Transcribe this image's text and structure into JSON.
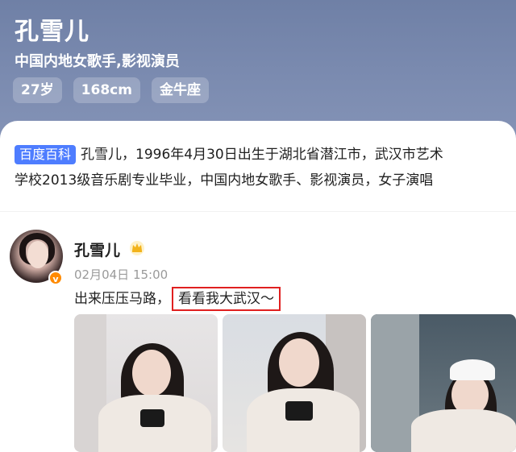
{
  "profile": {
    "name": "孔雪儿",
    "subtitle": "中国内地女歌手,影视演员",
    "tags": [
      "27岁",
      "168cm",
      "金牛座"
    ]
  },
  "intro": {
    "badge": "百度百科",
    "line1": "孔雪儿，1996年4月30日出生于湖北省潜江市，武汉市艺术",
    "line2": "学校2013级音乐剧专业毕业，中国内地女歌手、影视演员，女子演唱"
  },
  "post": {
    "author": "孔雪儿",
    "author_icons": [
      "crown-icon",
      "verified-icon"
    ],
    "verify_mark": "v",
    "time": "02月04日 15:00",
    "text_plain": "出来压压马路，",
    "text_highlight": "看看我大武汉～",
    "highlight_color": "#e02020"
  },
  "colors": {
    "header_bg": "#7b8bb0",
    "badge_bg": "#4e7dff",
    "verify_bg": "#ff8a00"
  }
}
